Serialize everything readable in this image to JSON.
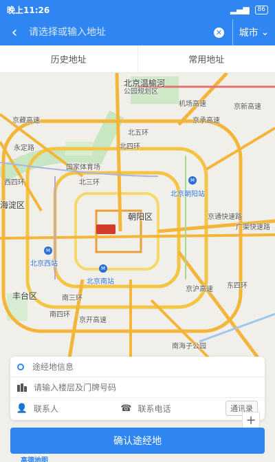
{
  "status": {
    "time": "晚上11:26",
    "battery": "86"
  },
  "search": {
    "placeholder": "请选择或输入地址",
    "city": "城市"
  },
  "tabs": [
    {
      "label": "历史地址"
    },
    {
      "label": "常用地址"
    }
  ],
  "map": {
    "labels": {
      "beiyuan": "北京温榆河",
      "park": "公园规划区",
      "chaoyang": "朝阳区",
      "haidian": "海淀区",
      "fengtai": "丰台区",
      "guojia": "国家体育场",
      "bw5": "北五环",
      "bw4": "北四环",
      "bw3": "北三环",
      "xs": "西四环",
      "ns": "南三环",
      "n4": "南四环",
      "ds": "东四环",
      "bjczhan": "北京朝阳站",
      "bjxz": "北京西站",
      "bjnz": "北京南站",
      "jct": "京承高速",
      "jct2": "机场高速",
      "jtkd": "京通快速路",
      "gqkd": "广渠快速路",
      "nhzg": "南海子公园",
      "jhgs": "京沪高速",
      "jlt": "京开高速",
      "jzgs": "京藏高速",
      "yf": "永定路",
      "jbgs": "京新高速"
    }
  },
  "card": {
    "waypoint": "途经地信息",
    "floor_placeholder": "请输入楼层及门牌号码",
    "contact_placeholder": "联系人",
    "phone_placeholder": "联系电话",
    "book_label": "通讯录"
  },
  "confirm_label": "确认途经地",
  "logo": "高德地图",
  "colors": {
    "primary": "#2f86f2"
  }
}
